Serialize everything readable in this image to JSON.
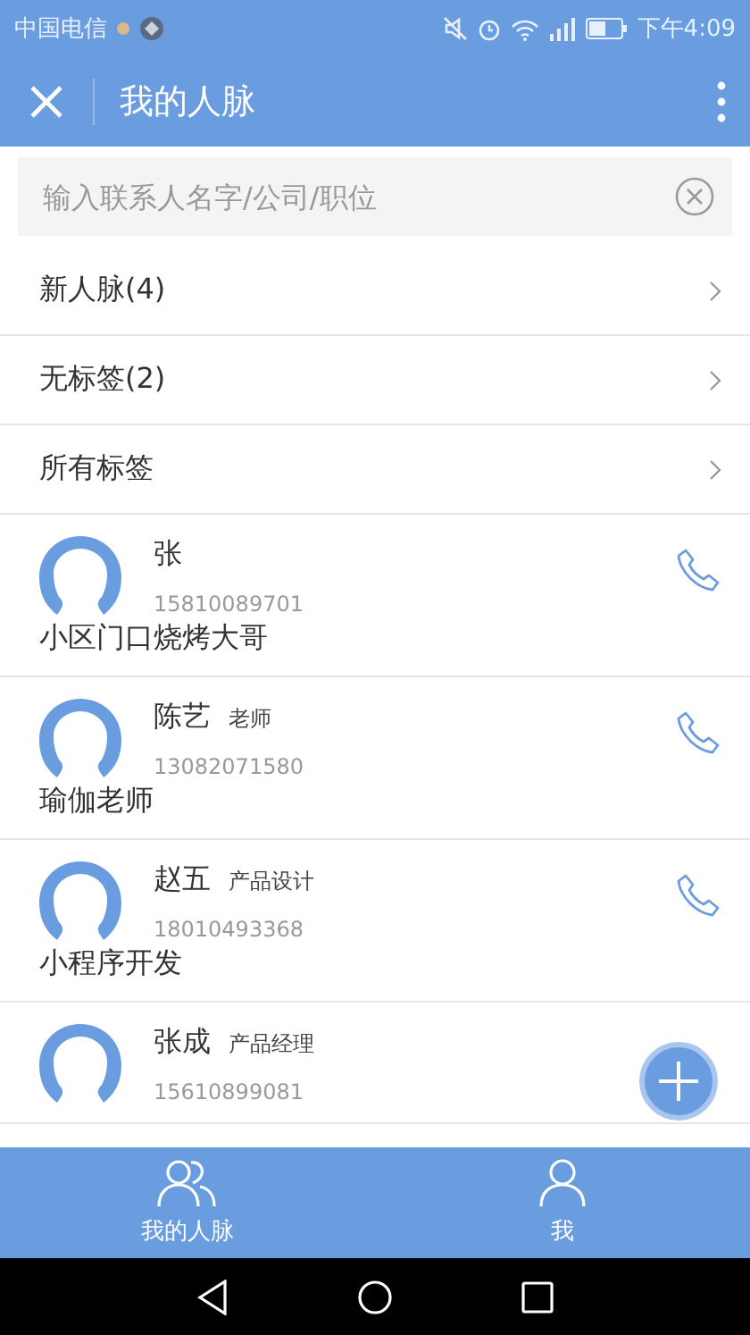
{
  "status_bar": {
    "carrier": "中国电信",
    "time": "下午4:09"
  },
  "header": {
    "title": "我的人脉"
  },
  "search": {
    "placeholder": "输入联系人名字/公司/职位"
  },
  "menu": [
    {
      "label": "新人脉(4)"
    },
    {
      "label": "无标签(2)"
    },
    {
      "label": "所有标签"
    }
  ],
  "contacts": [
    {
      "name": "张",
      "phone": "15810089701",
      "note": "小区门口烧烤大哥",
      "call_icon": true
    },
    {
      "name": "陈艺",
      "title": "老师",
      "phone": "13082071580",
      "note": "瑜伽老师",
      "call_icon": true
    },
    {
      "name": "赵五",
      "title": "产品设计",
      "phone": "18010493368",
      "note": "小程序开发",
      "call_icon": true
    },
    {
      "name": "张成",
      "title": "产品经理",
      "phone": "15610899081",
      "call_icon": false
    }
  ],
  "tab_bar": [
    {
      "label": "我的人脉",
      "kind": "people"
    },
    {
      "label": "我",
      "kind": "person"
    }
  ]
}
